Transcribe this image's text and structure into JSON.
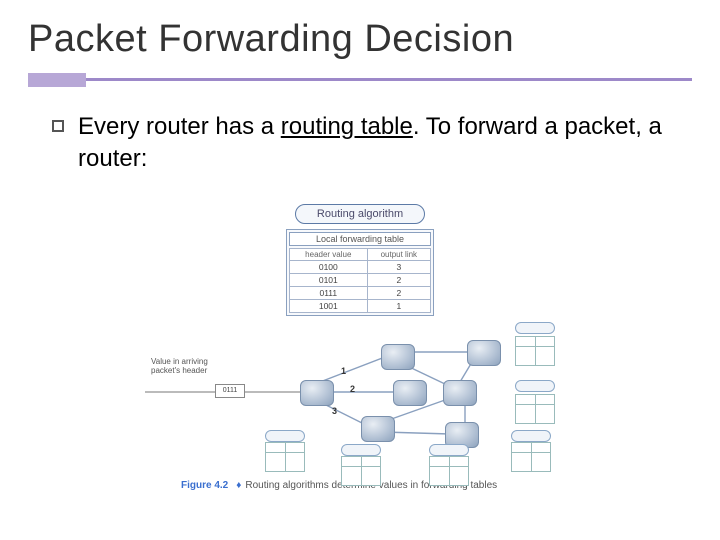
{
  "slide": {
    "title": "Packet Forwarding Decision",
    "bullet": {
      "pre": "Every router has a ",
      "underlined": "routing table",
      "post": ". To forward a packet, a router:"
    }
  },
  "figure": {
    "routing_algorithm_label": "Routing algorithm",
    "local_forwarding_label": "Local forwarding table",
    "table": {
      "headers": {
        "col1": "header value",
        "col2": "output link"
      },
      "rows": [
        {
          "hv": "0100",
          "ol": "3"
        },
        {
          "hv": "0101",
          "ol": "2"
        },
        {
          "hv": "0111",
          "ol": "2"
        },
        {
          "hv": "1001",
          "ol": "1"
        }
      ]
    },
    "arriving_label": "Value in arriving\npacket's header",
    "packet_header": "0111",
    "ports": {
      "p1": "1",
      "p2": "2",
      "p3": "3"
    },
    "caption": {
      "fignum": "Figure 4.2",
      "text": "Routing algorithms determine values in forwarding tables"
    }
  }
}
